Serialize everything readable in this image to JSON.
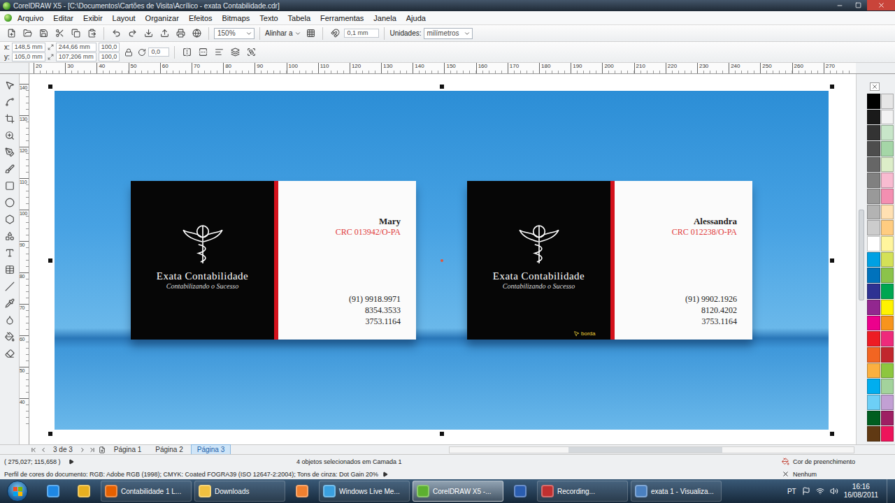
{
  "window": {
    "title": "CorelDRAW X5 - [C:\\Documentos\\Cartões de Visita\\Acrílico - exata Contabilidade.cdr]"
  },
  "menu": [
    "Arquivo",
    "Editar",
    "Exibir",
    "Layout",
    "Organizar",
    "Efeitos",
    "Bitmaps",
    "Texto",
    "Tabela",
    "Ferramentas",
    "Janela",
    "Ajuda"
  ],
  "toolbar": {
    "zoom": "150%",
    "snap": "Alinhar a",
    "nudge": "0,1 mm",
    "units_label": "Unidades:",
    "units": "milímetros"
  },
  "properties": {
    "x_label": "x:",
    "x": "148,5 mm",
    "y_label": "y:",
    "y": "105,0 mm",
    "width": "244,66 mm",
    "height": "107,206 mm",
    "scale_x": "100,0",
    "scale_y": "100,0",
    "rotation": "0,0"
  },
  "ruler": {
    "horizontal": [
      "20",
      "30",
      "40",
      "50",
      "60",
      "70",
      "80",
      "90",
      "100",
      "110",
      "120",
      "130",
      "140",
      "150",
      "160",
      "170",
      "180",
      "190",
      "200",
      "210",
      "220",
      "230",
      "240",
      "250",
      "260",
      "270"
    ],
    "vertical": [
      "140",
      "130",
      "120",
      "110",
      "100",
      "90",
      "80",
      "70",
      "60",
      "50",
      "40"
    ]
  },
  "cards": [
    {
      "company": "Exata Contabilidade",
      "tagline": "Contabilizando o Sucesso",
      "name": "Mary",
      "registry": "CRC 013942/O-PA",
      "phones": [
        "(91) 9918.9971",
        "8354.3533",
        "3753.1164"
      ]
    },
    {
      "company": "Exata Contabilidade",
      "tagline": "Contabilizando o Sucesso",
      "name": "Alessandra",
      "registry": "CRC 012238/O-PA",
      "phones": [
        "(91) 9902.1926",
        "8120.4202",
        "3753.1164"
      ],
      "hint": "borda"
    }
  ],
  "pages": {
    "counter": "3 de 3",
    "tabs": [
      {
        "label": "Página 1",
        "selected": false
      },
      {
        "label": "Página 2",
        "selected": false
      },
      {
        "label": "Página 3",
        "selected": true
      }
    ]
  },
  "status": {
    "coords": "( 275,027; 115,658 )",
    "selection": "4 objetos selecionados em Camada 1",
    "fill": "Cor de preenchimento",
    "outline": "Nenhum",
    "profile": "Perfil de cores do documento: RGB: Adobe RGB (1998); CMYK: Coated FOGRA39 (ISO 12647-2:2004); Tons de cinza: Dot Gain 20%"
  },
  "palette": [
    "#000000",
    "#e6e6e6",
    "#1a1a1a",
    "#f2f2f2",
    "#333333",
    "#c8e6c9",
    "#4d4d4d",
    "#a5d6a7",
    "#666666",
    "#dcedc8",
    "#808080",
    "#f8bbd0",
    "#999999",
    "#f48fb1",
    "#b3b3b3",
    "#ffe0b2",
    "#cccccc",
    "#ffcc80",
    "#ffffff",
    "#fff59d",
    "#00a0e3",
    "#d4e157",
    "#0072bc",
    "#8bc34a",
    "#2e3192",
    "#00a651",
    "#92278f",
    "#fff200",
    "#ec008c",
    "#f7941d",
    "#ed1c24",
    "#ee2a7b",
    "#f26522",
    "#c1272d",
    "#fbb040",
    "#8dc63f",
    "#00aeef",
    "#a3d39c",
    "#6dcff6",
    "#c2a0d4",
    "#005e20",
    "#9e1f63",
    "#603913",
    "#ed145b"
  ],
  "taskbar": {
    "items": [
      {
        "kind": "icon",
        "color": "#1e88e5"
      },
      {
        "kind": "icon",
        "color": "#e8b020"
      },
      {
        "kind": "button",
        "label": "Contabilidade 1 L...",
        "active": false,
        "color": "#e66000"
      },
      {
        "kind": "button",
        "label": "Downloads",
        "active": false,
        "color": "#f0c040"
      },
      {
        "kind": "icon",
        "color": "#f08030"
      },
      {
        "kind": "button",
        "label": "Windows Live Me...",
        "active": false,
        "color": "#3aa0e0"
      },
      {
        "kind": "button",
        "label": "CorelDRAW X5 -...",
        "active": true,
        "color": "#5cb030"
      },
      {
        "kind": "icon",
        "color": "#2a5db0"
      },
      {
        "kind": "button",
        "label": "Recording...",
        "active": false,
        "color": "#c03030"
      },
      {
        "kind": "button",
        "label": "exata 1 - Visualiza...",
        "active": false,
        "color": "#4a80c0"
      }
    ],
    "language": "PT",
    "time": "16:16",
    "date": "16/08/2011"
  }
}
